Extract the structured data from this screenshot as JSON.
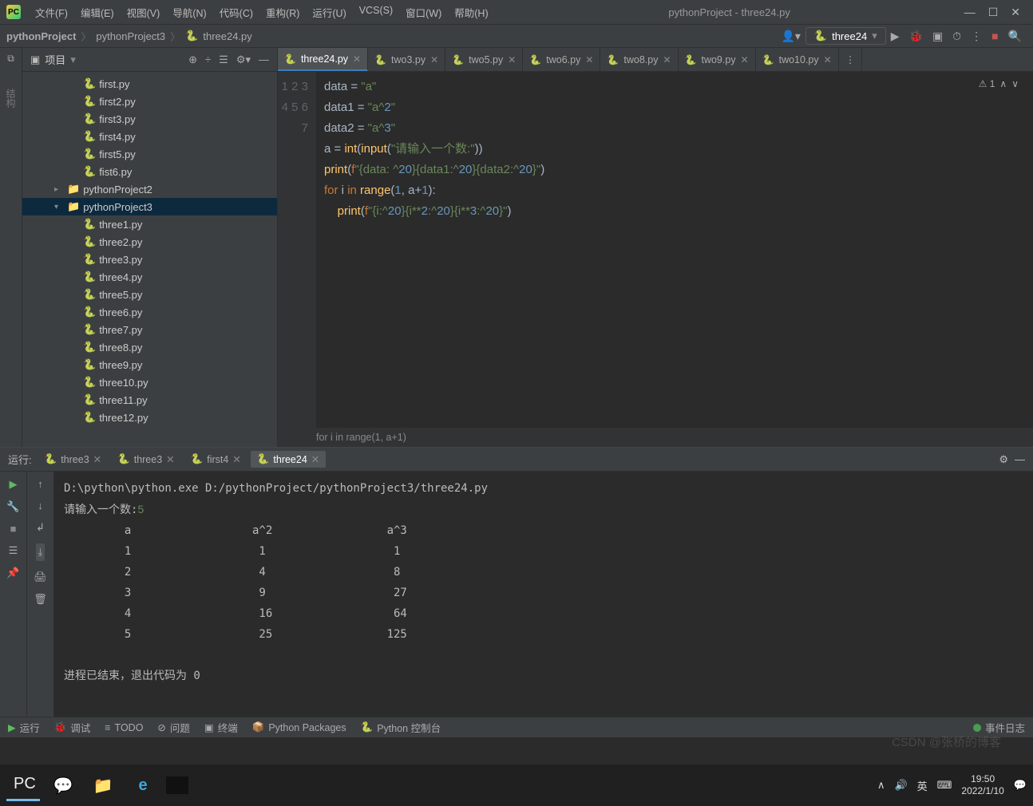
{
  "window": {
    "title": "pythonProject - three24.py",
    "menus": [
      "文件(F)",
      "编辑(E)",
      "视图(V)",
      "导航(N)",
      "代码(C)",
      "重构(R)",
      "运行(U)",
      "VCS(S)",
      "窗口(W)",
      "帮助(H)"
    ],
    "win_btns": [
      "—",
      "☐",
      "✕"
    ]
  },
  "breadcrumb": [
    "pythonProject",
    "pythonProject3",
    "three24.py"
  ],
  "run_config": "three24",
  "sidebar": {
    "title": "项目",
    "items": [
      {
        "name": "first.py",
        "kind": "py",
        "indent": "indent1"
      },
      {
        "name": "first2.py",
        "kind": "py",
        "indent": "indent1"
      },
      {
        "name": "first3.py",
        "kind": "py",
        "indent": "indent1"
      },
      {
        "name": "first4.py",
        "kind": "py",
        "indent": "indent1"
      },
      {
        "name": "first5.py",
        "kind": "py",
        "indent": "indent1"
      },
      {
        "name": "fist6.py",
        "kind": "py",
        "indent": "indent1"
      },
      {
        "name": "pythonProject2",
        "kind": "folder",
        "indent": "indent1f",
        "arrow": "▸"
      },
      {
        "name": "pythonProject3",
        "kind": "folder",
        "indent": "indent1f",
        "arrow": "▾",
        "selected": true
      },
      {
        "name": "three1.py",
        "kind": "py",
        "indent": "indent1"
      },
      {
        "name": "three2.py",
        "kind": "py",
        "indent": "indent1"
      },
      {
        "name": "three3.py",
        "kind": "py",
        "indent": "indent1"
      },
      {
        "name": "three4.py",
        "kind": "py",
        "indent": "indent1"
      },
      {
        "name": "three5.py",
        "kind": "py",
        "indent": "indent1"
      },
      {
        "name": "three6.py",
        "kind": "py",
        "indent": "indent1"
      },
      {
        "name": "three7.py",
        "kind": "py",
        "indent": "indent1"
      },
      {
        "name": "three8.py",
        "kind": "py",
        "indent": "indent1"
      },
      {
        "name": "three9.py",
        "kind": "py",
        "indent": "indent1"
      },
      {
        "name": "three10.py",
        "kind": "py",
        "indent": "indent1"
      },
      {
        "name": "three11.py",
        "kind": "py",
        "indent": "indent1"
      },
      {
        "name": "three12.py",
        "kind": "py",
        "indent": "indent1"
      }
    ]
  },
  "tabs": [
    "three24.py",
    "two3.py",
    "two5.py",
    "two6.py",
    "two8.py",
    "two9.py",
    "two10.py"
  ],
  "active_tab_index": 0,
  "editor": {
    "problems": "⚠ 1",
    "breadcrumb_bottom": "for i in range(1, a+1)",
    "lines": [
      "data = \"a\"",
      "data1 = \"a^2\"",
      "data2 = \"a^3\"",
      "a = int(input(\"请输入一个数:\"))",
      "print(f\"{data: ^20}{data1:^20}{data2:^20}\")",
      "for i in range(1, a+1):",
      "    print(f\"{i:^20}{i**2:^20}{i**3:^20}\")"
    ]
  },
  "run": {
    "label": "运行:",
    "tabs": [
      "three3",
      "three3",
      "first4",
      "three24"
    ],
    "active_tab_index": 3,
    "cmd": "D:\\python\\python.exe D:/pythonProject/pythonProject3/three24.py",
    "prompt": "请输入一个数:",
    "input": "5",
    "header_row": [
      "a",
      "a^2",
      "a^3"
    ],
    "rows": [
      [
        1,
        1,
        1
      ],
      [
        2,
        4,
        8
      ],
      [
        3,
        9,
        27
      ],
      [
        4,
        16,
        64
      ],
      [
        5,
        25,
        125
      ]
    ],
    "exit": "进程已结束，退出代码为 0"
  },
  "bottom_tabs": [
    "运行",
    "调试",
    "TODO",
    "问题",
    "终端",
    "Python Packages",
    "Python 控制台"
  ],
  "bottom_right": "事件日志",
  "gutter_labels": {
    "file_icon": "⧉",
    "vertical": "结构"
  },
  "taskbar": {
    "tasks": [
      "PC",
      "💬",
      "📁",
      "e",
      "▮"
    ],
    "tray": [
      "∧",
      "🔊",
      "英",
      "⌨"
    ],
    "time": "19:50",
    "date": "2022/1/10"
  },
  "watermark": "CSDN @张桥的博客"
}
